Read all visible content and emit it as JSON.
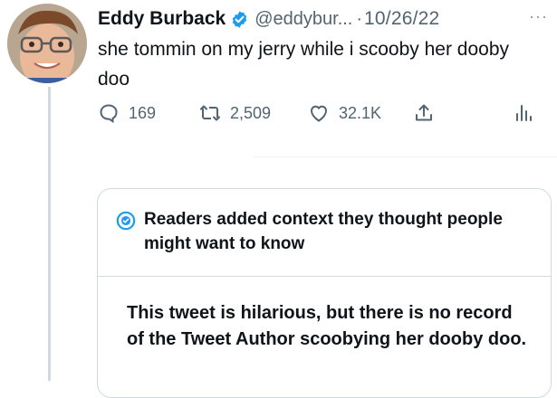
{
  "tweet": {
    "author_name": "Eddy Burback",
    "handle": "@eddybur...",
    "separator": "·",
    "date": "10/26/22",
    "more_glyph": "···",
    "text": "she tommin on my jerry while i scooby her dooby doo",
    "actions": {
      "reply_count": "169",
      "retweet_count": "2,509",
      "like_count": "32.1K"
    }
  },
  "community_note": {
    "header": "Readers added context they thought people might want to know",
    "body": "This tweet is hilarious, but there is no record of the Tweet Author scoobying her dooby doo."
  },
  "colors": {
    "verified_badge": "#1d9bf0",
    "muted_text": "#536471",
    "border": "#cfd9de",
    "text": "#0f1419"
  },
  "icons": {
    "verified": "verified-badge-icon",
    "reply": "reply-icon",
    "retweet": "retweet-icon",
    "like": "heart-icon",
    "share": "share-icon",
    "analytics": "analytics-icon",
    "note": "community-notes-icon"
  }
}
